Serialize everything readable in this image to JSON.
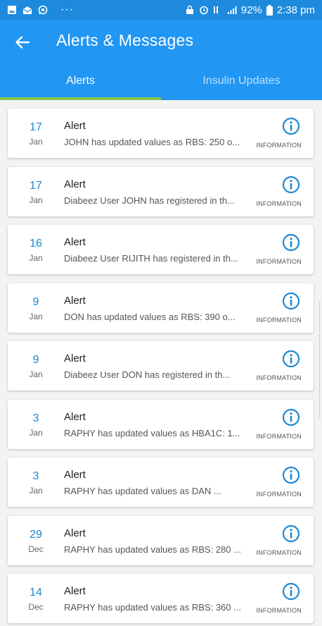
{
  "status_bar": {
    "battery_percent": "92%",
    "time": "2:38 pm",
    "dots": "···"
  },
  "header": {
    "title": "Alerts & Messages"
  },
  "tabs": [
    {
      "label": "Alerts",
      "active": true
    },
    {
      "label": "Insulin Updates",
      "active": false
    }
  ],
  "colors": {
    "status_bar": "#1d8ade",
    "app_bar": "#2196f3",
    "tab_indicator": "#8bc34a",
    "date_day": "#1e88d2",
    "info_icon": "#1e88d2"
  },
  "alerts": [
    {
      "day": "17",
      "month": "Jan",
      "title": "Alert",
      "message": "JOHN has updated values as RBS: 250 o...",
      "type_label": "INFORMATION",
      "icon": "info-icon"
    },
    {
      "day": "17",
      "month": "Jan",
      "title": "Alert",
      "message": "Diabeez User JOHN has registered in th...",
      "type_label": "INFORMATION",
      "icon": "info-icon"
    },
    {
      "day": "16",
      "month": "Jan",
      "title": "Alert",
      "message": "Diabeez User RIJITH has registered in th...",
      "type_label": "INFORMATION",
      "icon": "info-icon"
    },
    {
      "day": "9",
      "month": "Jan",
      "title": "Alert",
      "message": "DON has updated values as RBS: 390 o...",
      "type_label": "INFORMATION",
      "icon": "info-icon"
    },
    {
      "day": "9",
      "month": "Jan",
      "title": "Alert",
      "message": "Diabeez User DON has registered in th...",
      "type_label": "INFORMATION",
      "icon": "info-icon"
    },
    {
      "day": "3",
      "month": "Jan",
      "title": "Alert",
      "message": "RAPHY has updated values as HBA1C: 1...",
      "type_label": "INFORMATION",
      "icon": "info-icon"
    },
    {
      "day": "3",
      "month": "Jan",
      "title": "Alert",
      "message": "RAPHY has updated values as DAN ...",
      "type_label": "INFORMATION",
      "icon": "info-icon"
    },
    {
      "day": "29",
      "month": "Dec",
      "title": "Alert",
      "message": "RAPHY has updated values as RBS: 280 ...",
      "type_label": "INFORMATION",
      "icon": "info-icon"
    },
    {
      "day": "14",
      "month": "Dec",
      "title": "Alert",
      "message": "RAPHY has updated values as RBS: 360 ...",
      "type_label": "INFORMATION",
      "icon": "info-icon"
    }
  ]
}
